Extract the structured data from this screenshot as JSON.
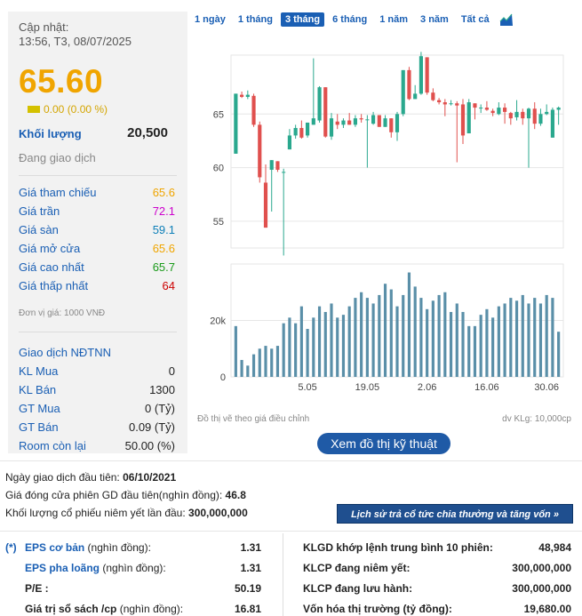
{
  "summary": {
    "updated_label": "Cập nhật:",
    "updated_time": "13:56, T3, 08/07/2025",
    "price": "65.60",
    "change": "0.00 (0.00 %)",
    "volume_label": "Khối lượng",
    "volume_value": "20,500",
    "status": "Đang giao dịch"
  },
  "prices": [
    {
      "label": "Giá tham chiếu",
      "value": "65.6",
      "color": "#f0a500"
    },
    {
      "label": "Giá trần",
      "value": "72.1",
      "color": "#cc00cc"
    },
    {
      "label": "Giá sàn",
      "value": "59.1",
      "color": "#0d7fb8"
    },
    {
      "label": "Giá mở cửa",
      "value": "65.6",
      "color": "#f0a500"
    },
    {
      "label": "Giá cao nhất",
      "value": "65.7",
      "color": "#1a9a1a"
    },
    {
      "label": "Giá thấp nhất",
      "value": "64",
      "color": "#cc0000"
    }
  ],
  "unit_note": "Đơn vị giá: 1000 VNĐ",
  "foreign": [
    {
      "label": "Giao dịch NĐTNN",
      "value": ""
    },
    {
      "label": "KL Mua",
      "value": "0"
    },
    {
      "label": "KL Bán",
      "value": "1300"
    },
    {
      "label": "GT Mua",
      "value": "0 (Tỷ)"
    },
    {
      "label": "GT Bán",
      "value": "0.09 (Tỷ)"
    },
    {
      "label": "Room còn lại",
      "value": "50.00 (%)"
    }
  ],
  "tabs": [
    "1 ngày",
    "1 tháng",
    "3 tháng",
    "6 tháng",
    "1 năm",
    "3 năm",
    "Tất cả"
  ],
  "active_tab": "3 tháng",
  "chart_notes": {
    "left": "Đồ thị vẽ theo giá điều chỉnh",
    "right": "dv KLg: 10,000cp"
  },
  "tech_button": "Xem đồ thị kỹ thuật",
  "info_lines": [
    {
      "label": "Ngày giao dịch đầu tiên: ",
      "value": "06/10/2021"
    },
    {
      "label": "Giá đóng cửa phiên GD đầu tiên(nghìn đồng): ",
      "value": "46.8"
    },
    {
      "label": "Khối lượng cổ phiếu niêm yết lần đầu: ",
      "value": "300,000,000"
    }
  ],
  "history_button": "Lịch sử trả cổ tức chia thưởng và tăng vốn »",
  "fundamentals_left": [
    {
      "prefix": "(*)",
      "label": "EPS cơ bản",
      "unit": " (nghìn đồng):",
      "value": "1.31"
    },
    {
      "prefix": "",
      "label": "EPS pha loãng",
      "unit": " (nghìn đồng):",
      "value": "1.31"
    },
    {
      "prefix": "",
      "label": "P/E :",
      "unit": "",
      "value": "50.19"
    },
    {
      "prefix": "",
      "label": "Giá trị sổ sách /cp",
      "unit": " (nghìn đồng):",
      "value": "16.81"
    }
  ],
  "fundamentals_right": [
    {
      "label": "KLGD khớp lệnh trung bình 10 phiên:",
      "value": "48,984"
    },
    {
      "label": "KLCP đang niêm yết:",
      "value": "300,000,000"
    },
    {
      "label": "KLCP đang lưu hành:",
      "value": "300,000,000"
    },
    {
      "label": "Vốn hóa thị trường (tỷ đồng):",
      "value": "19,680.00"
    }
  ],
  "chart_data": {
    "type": "candlestick",
    "price_ticks": [
      55,
      60,
      65
    ],
    "price_range": [
      52.5,
      70.5
    ],
    "volume_ticks_labels": [
      "0",
      "20k"
    ],
    "volume_range": [
      0,
      40
    ],
    "x_labels": [
      "5.05",
      "19.05",
      "2.06",
      "16.06",
      "30.06"
    ],
    "candles": [
      {
        "o": 61.3,
        "h": 66.9,
        "l": 61.3,
        "c": 66.9,
        "v": 18
      },
      {
        "o": 66.8,
        "h": 67.1,
        "l": 66.5,
        "c": 66.6,
        "v": 6
      },
      {
        "o": 66.6,
        "h": 67.2,
        "l": 66.4,
        "c": 66.8,
        "v": 4
      },
      {
        "o": 66.7,
        "h": 66.9,
        "l": 63.8,
        "c": 64.0,
        "v": 8
      },
      {
        "o": 64.0,
        "h": 64.3,
        "l": 58.6,
        "c": 59.1,
        "v": 10
      },
      {
        "o": 58.6,
        "h": 60.3,
        "l": 54.4,
        "c": 54.4,
        "v": 11
      },
      {
        "o": 59.8,
        "h": 60.7,
        "l": 55.9,
        "c": 60.7,
        "v": 10
      },
      {
        "o": 60.6,
        "h": 60.6,
        "l": 59.6,
        "c": 59.8,
        "v": 11
      },
      {
        "o": 59.6,
        "h": 59.9,
        "l": 51.8,
        "c": 59.6,
        "v": 19
      },
      {
        "o": 61.7,
        "h": 63.6,
        "l": 61.7,
        "c": 63.0,
        "v": 21
      },
      {
        "o": 63.0,
        "h": 64.0,
        "l": 62.7,
        "c": 63.7,
        "v": 19
      },
      {
        "o": 63.7,
        "h": 64.4,
        "l": 62.7,
        "c": 62.8,
        "v": 25
      },
      {
        "o": 63.0,
        "h": 64.2,
        "l": 62.8,
        "c": 64.2,
        "v": 17
      },
      {
        "o": 64.0,
        "h": 70.2,
        "l": 64.0,
        "c": 64.6,
        "v": 21
      },
      {
        "o": 64.4,
        "h": 67.6,
        "l": 64.2,
        "c": 67.5,
        "v": 25
      },
      {
        "o": 67.5,
        "h": 67.5,
        "l": 62.8,
        "c": 62.9,
        "v": 23
      },
      {
        "o": 62.9,
        "h": 65.1,
        "l": 62.6,
        "c": 64.6,
        "v": 26
      },
      {
        "o": 64.3,
        "h": 65.0,
        "l": 63.6,
        "c": 64.0,
        "v": 21
      },
      {
        "o": 64.0,
        "h": 64.6,
        "l": 63.7,
        "c": 64.4,
        "v": 22
      },
      {
        "o": 64.4,
        "h": 65.1,
        "l": 64.0,
        "c": 64.0,
        "v": 25
      },
      {
        "o": 64.0,
        "h": 64.9,
        "l": 63.8,
        "c": 64.6,
        "v": 28
      },
      {
        "o": 64.6,
        "h": 65.0,
        "l": 64.2,
        "c": 64.5,
        "v": 30
      },
      {
        "o": 64.5,
        "h": 64.9,
        "l": 60.0,
        "c": 64.5,
        "v": 28
      },
      {
        "o": 64.1,
        "h": 65.2,
        "l": 64.0,
        "c": 64.9,
        "v": 26
      },
      {
        "o": 64.9,
        "h": 64.9,
        "l": 63.8,
        "c": 63.8,
        "v": 29
      },
      {
        "o": 63.8,
        "h": 64.9,
        "l": 63.8,
        "c": 64.6,
        "v": 33
      },
      {
        "o": 64.6,
        "h": 64.6,
        "l": 62.8,
        "c": 63.3,
        "v": 31
      },
      {
        "o": 63.3,
        "h": 65.2,
        "l": 62.5,
        "c": 65.0,
        "v": 25
      },
      {
        "o": 65.0,
        "h": 69.1,
        "l": 64.8,
        "c": 69.1,
        "v": 29
      },
      {
        "o": 69.1,
        "h": 69.4,
        "l": 66.3,
        "c": 66.4,
        "v": 37
      },
      {
        "o": 66.4,
        "h": 67.7,
        "l": 66.4,
        "c": 66.9,
        "v": 32
      },
      {
        "o": 66.9,
        "h": 70.8,
        "l": 66.8,
        "c": 70.4,
        "v": 28
      },
      {
        "o": 70.3,
        "h": 70.3,
        "l": 66.8,
        "c": 67.0,
        "v": 24
      },
      {
        "o": 67.0,
        "h": 67.4,
        "l": 66.2,
        "c": 66.3,
        "v": 27
      },
      {
        "o": 66.3,
        "h": 66.5,
        "l": 65.9,
        "c": 66.1,
        "v": 29
      },
      {
        "o": 66.1,
        "h": 66.4,
        "l": 64.8,
        "c": 65.9,
        "v": 30
      },
      {
        "o": 66.0,
        "h": 66.3,
        "l": 65.8,
        "c": 66.0,
        "v": 23
      },
      {
        "o": 66.0,
        "h": 66.2,
        "l": 60.5,
        "c": 65.8,
        "v": 26
      },
      {
        "o": 65.9,
        "h": 66.4,
        "l": 62.2,
        "c": 63.0,
        "v": 23
      },
      {
        "o": 63.2,
        "h": 66.4,
        "l": 63.2,
        "c": 66.1,
        "v": 18
      },
      {
        "o": 66.0,
        "h": 66.0,
        "l": 64.5,
        "c": 65.6,
        "v": 18
      },
      {
        "o": 65.6,
        "h": 65.9,
        "l": 65.1,
        "c": 65.6,
        "v": 22
      },
      {
        "o": 65.6,
        "h": 66.2,
        "l": 65.3,
        "c": 65.4,
        "v": 24
      },
      {
        "o": 65.3,
        "h": 65.5,
        "l": 64.8,
        "c": 65.1,
        "v": 21
      },
      {
        "o": 65.0,
        "h": 66.1,
        "l": 64.9,
        "c": 65.6,
        "v": 25
      },
      {
        "o": 65.6,
        "h": 66.0,
        "l": 64.1,
        "c": 65.2,
        "v": 26
      },
      {
        "o": 65.1,
        "h": 65.2,
        "l": 64.0,
        "c": 64.6,
        "v": 28
      },
      {
        "o": 64.7,
        "h": 66.3,
        "l": 64.4,
        "c": 65.2,
        "v": 27
      },
      {
        "o": 65.2,
        "h": 65.5,
        "l": 64.0,
        "c": 64.6,
        "v": 29
      },
      {
        "o": 64.6,
        "h": 65.6,
        "l": 60.0,
        "c": 65.5,
        "v": 26
      },
      {
        "o": 65.5,
        "h": 66.1,
        "l": 63.6,
        "c": 64.1,
        "v": 28
      },
      {
        "o": 64.1,
        "h": 65.5,
        "l": 63.9,
        "c": 65.0,
        "v": 26
      },
      {
        "o": 65.0,
        "h": 65.9,
        "l": 64.9,
        "c": 65.2,
        "v": 29
      },
      {
        "o": 62.8,
        "h": 65.6,
        "l": 62.8,
        "c": 65.4,
        "v": 28
      },
      {
        "o": 65.4,
        "h": 65.7,
        "l": 64.0,
        "c": 65.6,
        "v": 16
      }
    ],
    "colors": {
      "up": "#2aa88e",
      "down": "#e0504e",
      "volume": "#5a8fa8",
      "grid": "#e6e6e6"
    }
  }
}
